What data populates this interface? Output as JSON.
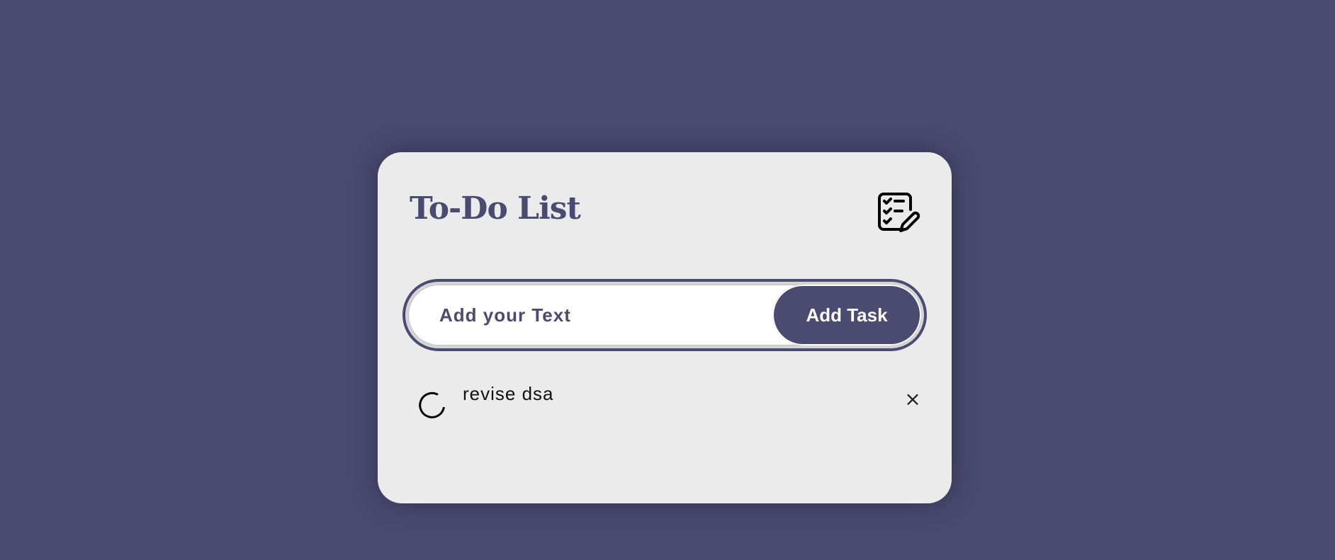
{
  "app": {
    "title": "To-Do List",
    "title_icon": "checklist-edit-icon"
  },
  "input": {
    "placeholder": "Add your Text",
    "value": ""
  },
  "add_button": {
    "label": "Add Task"
  },
  "tasks": [
    {
      "text": "revise dsa",
      "checked": false,
      "delete_label": "×"
    }
  ],
  "colors": {
    "background": "#4b4a71",
    "card": "#ebebec",
    "accent": "#4b4a71"
  }
}
